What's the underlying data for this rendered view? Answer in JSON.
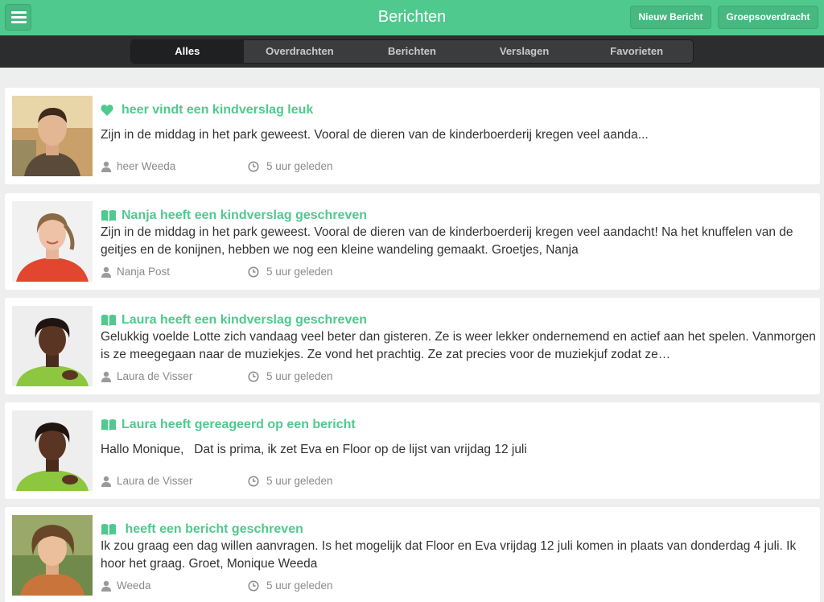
{
  "header": {
    "title": "Berichten",
    "new_message": "Nieuw Bericht",
    "group_transfer": "Groepsoverdracht",
    "accent_color": "#4fc98e"
  },
  "tabs": [
    "Alles",
    "Overdrachten",
    "Berichten",
    "Verslagen",
    "Favorieten"
  ],
  "active_tab": "Alles",
  "messages": [
    {
      "icon": "heart-icon",
      "title": "heer vindt een kindverslag leuk",
      "body": "Zijn in de middag in het park geweest. Vooral de dieren van de kinderboerderij kregen veel aanda...",
      "author": "heer Weeda",
      "time": "5 uur geleden"
    },
    {
      "icon": "book-icon",
      "title": "Nanja heeft een kindverslag geschreven",
      "body": " Zijn in de middag in het park geweest. Vooral de dieren van de kinderboerderij kregen veel aandacht! Na het knuffelen van de geitjes en de konijnen, hebben we nog een kleine wandeling gemaakt.  Groetjes, Nanja",
      "author": "Nanja Post",
      "time": "5 uur geleden"
    },
    {
      "icon": "book-icon",
      "title": "Laura heeft een kindverslag geschreven",
      "body": "Gelukkig voelde Lotte zich vandaag veel beter dan gisteren. Ze is weer lekker ondernemend en actief aan het spelen. Vanmorgen is ze meegegaan naar de muziekjes. Ze vond het prachtig. Ze zat precies voor de muziekjuf zodat ze…",
      "author": "Laura de Visser",
      "time": "5 uur geleden"
    },
    {
      "icon": "book-icon",
      "title": "Laura heeft gereageerd op een bericht",
      "body": "Hallo Monique,   Dat is prima, ik zet Eva en Floor op de lijst van vrijdag 12 juli",
      "author": "Laura de Visser",
      "time": "5 uur geleden"
    },
    {
      "icon": "book-icon",
      "title": " heeft een bericht geschreven",
      "body": "Ik zou graag een dag willen aanvragen. Is het mogelijk dat Floor en Eva vrijdag 12 juli komen in plaats van donderdag 4 juli. Ik hoor het graag.     Groet,    Monique Weeda",
      "author": "Weeda",
      "time": "5 uur geleden"
    }
  ]
}
